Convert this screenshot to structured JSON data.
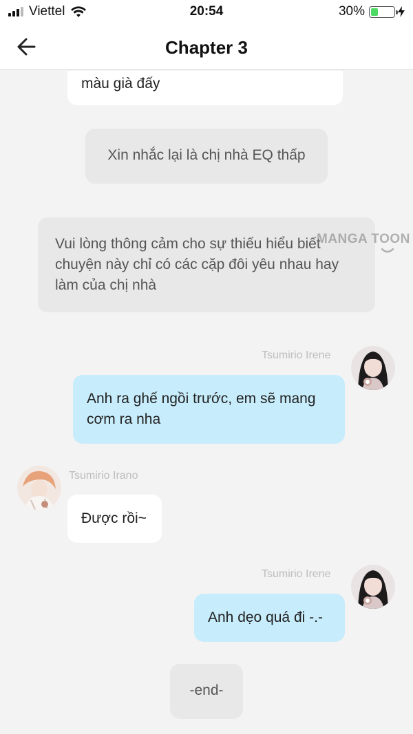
{
  "status_bar": {
    "carrier": "Viettel",
    "time": "20:54",
    "battery_percent_label": "30%",
    "battery_level": 0.3,
    "battery_color": "#4cd964"
  },
  "nav": {
    "title": "Chapter 3",
    "back_icon": "arrow-left-icon"
  },
  "watermark": "MANGA TOON",
  "messages": [
    {
      "type": "white",
      "text": "màu già đấy"
    },
    {
      "type": "narration",
      "text": "Xin nhắc lại là chị nhà EQ thấp"
    },
    {
      "type": "narration",
      "lines": [
        "Vui lòng thông cảm cho sự thiếu hiểu biết",
        "chuyện này chỉ có các cặp đôi yêu nhau hay",
        "làm của chị nhà"
      ]
    },
    {
      "type": "right",
      "sender": "Tsumirio Irene",
      "lines": [
        "Anh ra ghế ngồi trước, em sẽ mang",
        "cơm ra nha"
      ]
    },
    {
      "type": "left",
      "sender": "Tsumirio Irano",
      "text": "Được rồi~"
    },
    {
      "type": "right",
      "sender": "Tsumirio Irene",
      "text": "Anh dẹo quá đi -.-"
    },
    {
      "type": "narration",
      "text": "-end-"
    }
  ],
  "colors": {
    "background": "#f3f3f3",
    "blue_bubble": "#c7ecfb",
    "grey_bubble": "#e8e8e8"
  }
}
